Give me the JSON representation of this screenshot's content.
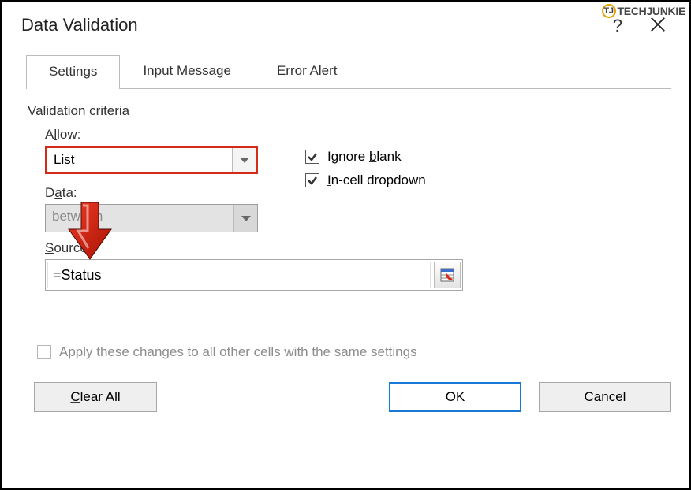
{
  "watermark": "TECHJUNKIE",
  "title": "Data Validation",
  "tabs": [
    {
      "label": "Settings",
      "active": true
    },
    {
      "label": "Input Message",
      "active": false
    },
    {
      "label": "Error Alert",
      "active": false
    }
  ],
  "criteria_heading": "Validation criteria",
  "allow": {
    "label_pre": "A",
    "label_u": "l",
    "label_post": "low:",
    "value": "List"
  },
  "data": {
    "label_pre": "D",
    "label_u": "a",
    "label_post": "ta:",
    "value": "between"
  },
  "checkboxes": {
    "ignore_blank": {
      "pre": "Ignore ",
      "u": "b",
      "post": "lank",
      "checked": true
    },
    "incell_dropdown": {
      "pre": "",
      "u": "I",
      "post": "n-cell dropdown",
      "checked": true
    }
  },
  "source": {
    "label_pre": "",
    "label_u": "S",
    "label_post": "ource:",
    "value": "=Status"
  },
  "apply": {
    "label_pre": "Apply these changes to all other cells with the same settings",
    "checked": false
  },
  "buttons": {
    "clear_pre": "",
    "clear_u": "C",
    "clear_post": "lear All",
    "ok": "OK",
    "cancel": "Cancel"
  }
}
